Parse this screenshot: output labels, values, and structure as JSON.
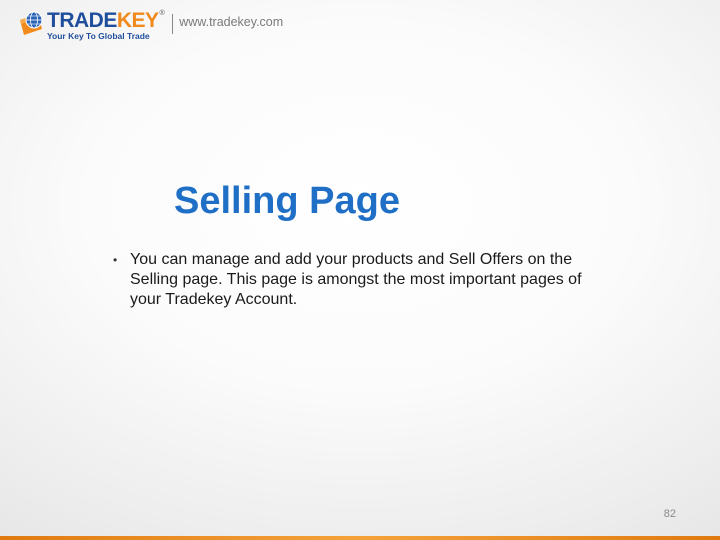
{
  "header": {
    "logo_word_primary": "TRADE",
    "logo_word_accent": "KEY",
    "logo_registered": "®",
    "logo_tagline": "Your Key To Global Trade",
    "url": "www.tradekey.com"
  },
  "slide": {
    "title": "Selling Page",
    "bullets": [
      {
        "text": "You can manage and add your products and Sell Offers on the Selling page. This page is amongst the most important pages of your Tradekey Account."
      }
    ],
    "page_number": "82"
  },
  "colors": {
    "brand_blue": "#1f4e9c",
    "brand_orange": "#f08a1c",
    "title_blue": "#1f6fc6"
  },
  "icons": {
    "logo_mark": "globe-key-icon",
    "bullet": "bullet-dot-icon"
  }
}
